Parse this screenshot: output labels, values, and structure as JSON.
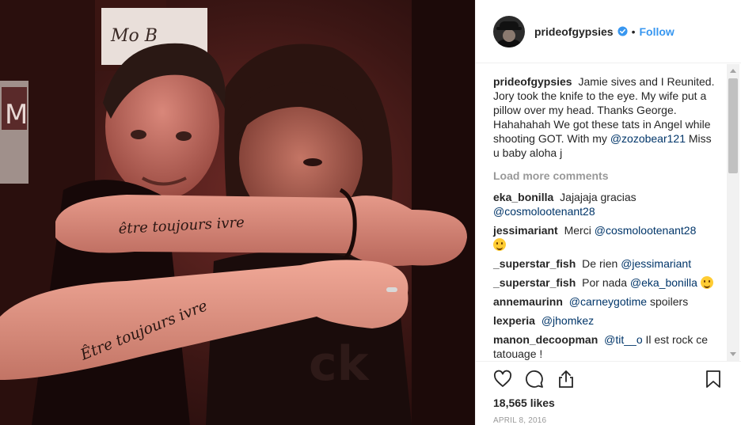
{
  "post": {
    "owner": "prideofgypsies",
    "dot": "•",
    "follow_label": "Follow",
    "caption_user": "prideofgypsies",
    "caption_text": "Jamie sives and I Reunited. Jory took the knife to the eye. My wife put a pillow over my head. Thanks George. Hahahahah We got these tats in Angel while shooting GOT. With my",
    "caption_mention": "@zozobear121",
    "caption_tail": "Miss u baby aloha j",
    "load_more": "Load more comments",
    "likes": "18,565 likes",
    "date": "APRIL 8, 2016"
  },
  "comments": [
    {
      "user": "eka_bonilla",
      "text": "Jajajaja gracias",
      "mention": "@cosmolootenant28",
      "after": ""
    },
    {
      "user": "jessimariant",
      "text": "Merci",
      "mention": "@cosmolootenant28",
      "after": ""
    },
    {
      "user": "_superstar_fish",
      "text": "De rien",
      "mention": "@jessimariant",
      "after": ""
    },
    {
      "user": "_superstar_fish",
      "text": "Por nada",
      "mention": "@eka_bonilla",
      "after": ""
    },
    {
      "user": "annemaurinn",
      "text": "",
      "mention": "@carneygotime",
      "after": "spoilers"
    },
    {
      "user": "lexperia",
      "text": "",
      "mention": "@jhomkez",
      "after": ""
    },
    {
      "user": "manon_decoopman",
      "text": "",
      "mention": "@tit__o",
      "after": "Il est rock ce tatouage !"
    }
  ],
  "photo": {
    "tattoo_top": "être toujours ivre",
    "tattoo_bottom": "Être toujours ivre",
    "poster_text": "M"
  },
  "icons": {
    "like": "heart-icon",
    "comment": "comment-icon",
    "share": "share-icon",
    "save": "bookmark-icon",
    "verified": "verified-badge-icon"
  },
  "colors": {
    "link": "#3897f0",
    "mention": "#003569",
    "muted": "#999999",
    "text": "#262626"
  }
}
